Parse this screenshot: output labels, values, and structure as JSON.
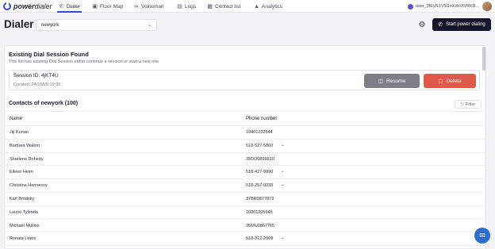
{
  "brand": {
    "name_prefix": "power",
    "name_suffix": "dialer"
  },
  "nav": {
    "tabs": [
      {
        "label": "Dialer",
        "icon": "phone-icon",
        "active": true
      },
      {
        "label": "Floor Map",
        "icon": "video-icon",
        "active": false
      },
      {
        "label": "Voicemail",
        "icon": "voicemail-icon",
        "active": false
      },
      {
        "label": "Logs",
        "icon": "logs-icon",
        "active": false
      },
      {
        "label": "Contact list",
        "icon": "contact-list-icon",
        "active": false
      },
      {
        "label": "Analytics",
        "icon": "analytics-icon",
        "active": false
      }
    ],
    "user_label": "user_2fEyN1V5GoXzbVtVRKB..."
  },
  "header": {
    "title": "Dialer",
    "list_select": {
      "value": "newyork"
    },
    "start_button": "Start power dialing"
  },
  "session": {
    "title": "Existing Dial Session Found",
    "subtitle": "This list has existing Dial Session either continue a session or start a new one",
    "id_label": "Session ID: 4jKT4U",
    "created_label": "Created: 24/10/08 19:35",
    "resume_label": "Resume",
    "delete_label": "Delete"
  },
  "contacts": {
    "title": "Contacts of newyork (100)",
    "filter_label": "Filter",
    "columns": [
      "Name",
      "Phone number"
    ],
    "rows": [
      {
        "name": "Jiji Kurian",
        "phone": "10401222544",
        "has_dropdown": false
      },
      {
        "name": "Barbara Walton",
        "phone": "518-527-5800",
        "has_dropdown": true
      },
      {
        "name": "Sharlene Doherty",
        "phone": "35DO0899510",
        "has_dropdown": false
      },
      {
        "name": "Eileen Heim",
        "phone": "518-427-9090",
        "has_dropdown": true
      },
      {
        "name": "Christina Hennessy",
        "phone": "518-257-0233",
        "has_dropdown": true
      },
      {
        "name": "Karl Brodsky",
        "phone": "37BR0877873",
        "has_dropdown": false
      },
      {
        "name": "Laurie Tylenda",
        "phone": "10301205946",
        "has_dropdown": false
      },
      {
        "name": "Michael Mullins",
        "phone": "35MU0867765",
        "has_dropdown": false
      },
      {
        "name": "Renata Lewis",
        "phone": "518-312-2069",
        "has_dropdown": true
      }
    ]
  },
  "colors": {
    "accent": "#2f4fd8",
    "primary_dark": "#14172a",
    "delete": "#e05a4c",
    "resume": "#7c7f88"
  }
}
